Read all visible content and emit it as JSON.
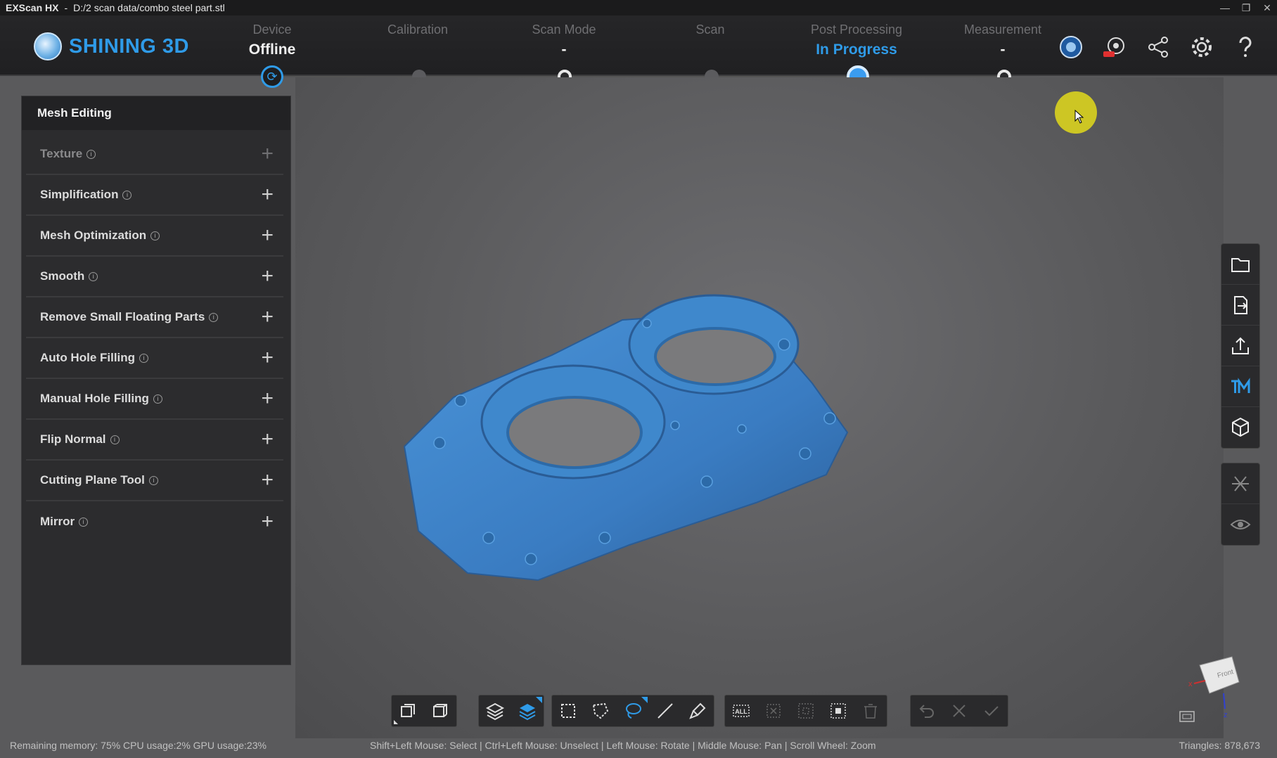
{
  "titlebar": {
    "app": "EXScan HX",
    "separator": "-",
    "path": "D:/2 scan data/combo steel  part.stl",
    "controls": [
      "—",
      "❐",
      "✕"
    ]
  },
  "logo": {
    "text": "SHINING 3D"
  },
  "steps": [
    {
      "label": "Device",
      "value": "Offline",
      "state": "sync"
    },
    {
      "label": "Calibration",
      "value": "",
      "state": "gray"
    },
    {
      "label": "Scan Mode",
      "value": "-",
      "state": "ring"
    },
    {
      "label": "Scan",
      "value": "",
      "state": "gray"
    },
    {
      "label": "Post Processing",
      "value": "In Progress",
      "state": "active"
    },
    {
      "label": "Measurement",
      "value": "-",
      "state": "ring"
    }
  ],
  "top_icons": [
    "model-icon",
    "new-feature-icon",
    "share-icon",
    "settings-icon",
    "help-icon"
  ],
  "panel": {
    "title": "Mesh Editing",
    "info_glyph": "i",
    "plus_glyph": "+",
    "items": [
      {
        "label": "Texture",
        "disabled": true
      },
      {
        "label": "Simplification",
        "disabled": false
      },
      {
        "label": "Mesh Optimization",
        "disabled": false
      },
      {
        "label": "Smooth",
        "disabled": false
      },
      {
        "label": "Remove Small Floating Parts",
        "disabled": false
      },
      {
        "label": "Auto Hole Filling",
        "disabled": false
      },
      {
        "label": "Manual Hole Filling",
        "disabled": false
      },
      {
        "label": "Flip Normal",
        "disabled": false
      },
      {
        "label": "Cutting Plane Tool",
        "disabled": false
      },
      {
        "label": "Mirror",
        "disabled": false
      }
    ]
  },
  "right_toolbar": [
    "open-folder-icon",
    "import-icon",
    "export-icon",
    "tm-icon",
    "cube-icon"
  ],
  "right_toolbar2": [
    "cross-section-icon",
    "visibility-icon"
  ],
  "bottom_toolbar": {
    "all_label": "ALL"
  },
  "viewcube": {
    "face_label": "Front",
    "x_label": "x",
    "z_label": "z"
  },
  "status": {
    "left": "Remaining memory: 75% CPU usage:2%  GPU usage:23%",
    "mid": "Shift+Left Mouse: Select | Ctrl+Left Mouse: Unselect | Left Mouse: Rotate | Middle Mouse: Pan | Scroll Wheel: Zoom",
    "right": "Triangles: 878,673"
  },
  "colors": {
    "accent": "#2f9be8",
    "model": "#3a7cc2",
    "panel": "#2c2c2e",
    "highlight": "#d4cc22"
  }
}
